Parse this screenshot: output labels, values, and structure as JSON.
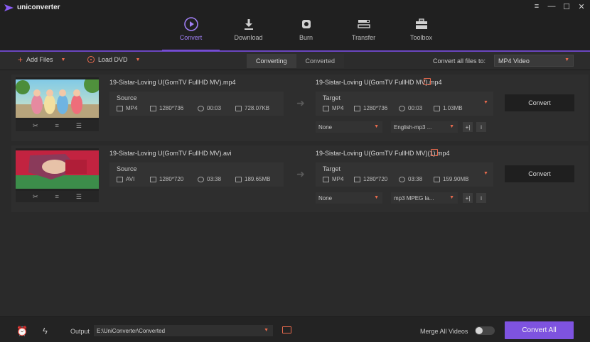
{
  "app": {
    "brand": "uniconverter",
    "window_controls": [
      "≡",
      "—",
      "☐",
      "✕"
    ]
  },
  "nav": {
    "items": [
      {
        "label": "Convert",
        "icon": "convert-play-icon",
        "active": true
      },
      {
        "label": "Download",
        "icon": "download-icon",
        "active": false
      },
      {
        "label": "Burn",
        "icon": "burn-disc-icon",
        "active": false
      },
      {
        "label": "Transfer",
        "icon": "transfer-icon",
        "active": false
      },
      {
        "label": "Toolbox",
        "icon": "toolbox-icon",
        "active": false
      }
    ]
  },
  "toolbar": {
    "add_files": "Add Files",
    "load_dvd": "Load DVD",
    "tabs": [
      "Converting",
      "Converted"
    ],
    "convert_all_label": "Convert all files to:",
    "format": "MP4 Video"
  },
  "files": [
    {
      "name": "19-Sistar-Loving U(GomTV FullHD MV).mp4",
      "source": {
        "title": "Source",
        "format": "MP4",
        "resolution": "1280*736",
        "duration": "00:03",
        "size": "728.07KB"
      },
      "target_name": "19-Sistar-Loving U(GomTV FullHD MV).mp4",
      "target": {
        "title": "Target",
        "format": "MP4",
        "resolution": "1280*736",
        "duration": "00:03",
        "size": "1.03MB"
      },
      "subtitle": "None",
      "audio": "English-mp3 ...",
      "convert_label": "Convert"
    },
    {
      "name": "19-Sistar-Loving U(GomTV FullHD MV).avi",
      "source": {
        "title": "Source",
        "format": "AVI",
        "resolution": "1280*720",
        "duration": "03:38",
        "size": "189.65MB"
      },
      "target_name": "19-Sistar-Loving U(GomTV FullHD MV)(1).mp4",
      "target": {
        "title": "Target",
        "format": "MP4",
        "resolution": "1280*720",
        "duration": "03:38",
        "size": "159.90MB"
      },
      "subtitle": "None",
      "audio": "mp3 MPEG la...",
      "convert_label": "Convert"
    }
  ],
  "bottom": {
    "output_label": "Output",
    "output_path": "E:\\UniConverter\\Converted",
    "merge_label": "Merge All Videos",
    "merge_on": false,
    "convert_all": "Convert All"
  },
  "colors": {
    "accent": "#8a5cf6",
    "orange": "#e96a4d",
    "bg": "#2a2a2a"
  }
}
